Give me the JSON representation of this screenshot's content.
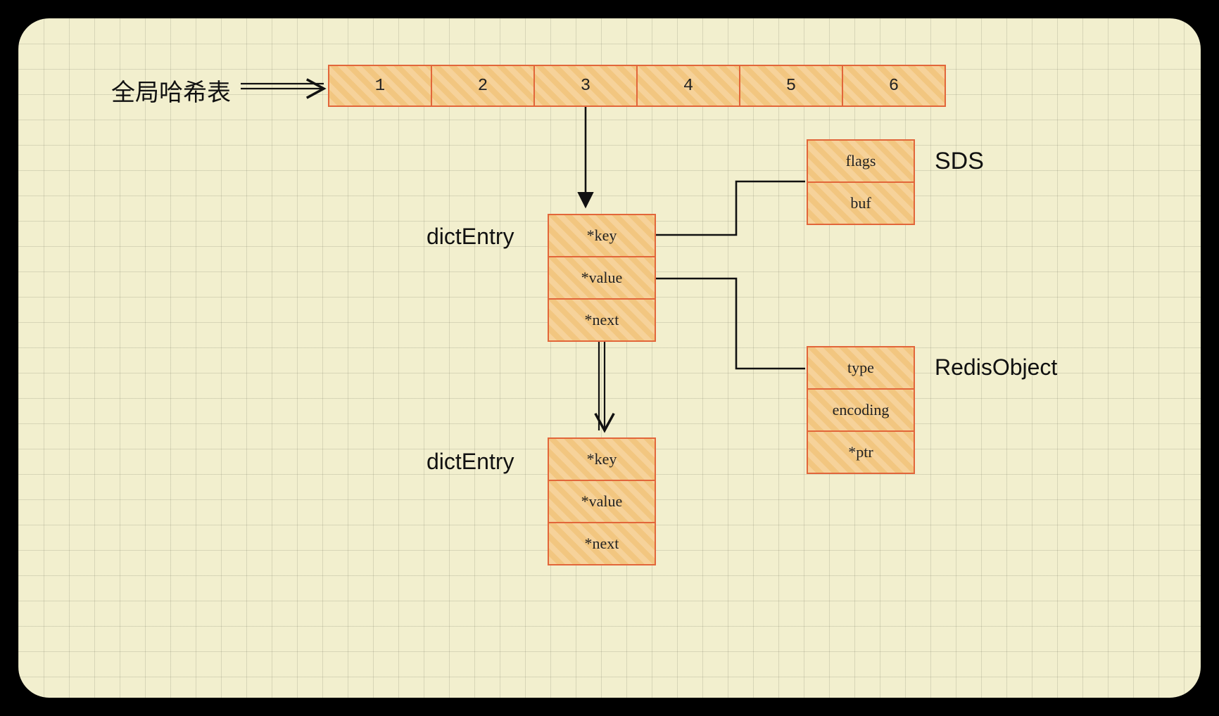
{
  "labels": {
    "hash_table": "全局哈希表",
    "dict_entry_1": "dictEntry",
    "dict_entry_2": "dictEntry",
    "sds": "SDS",
    "redis_object": "RedisObject"
  },
  "hash_row": [
    "1",
    "2",
    "3",
    "4",
    "5",
    "6"
  ],
  "dict_entry": {
    "key": "*key",
    "value": "*value",
    "next": "*next"
  },
  "sds": {
    "flags": "flags",
    "buf": "buf"
  },
  "redis_object": {
    "type": "type",
    "encoding": "encoding",
    "ptr": "*ptr"
  }
}
